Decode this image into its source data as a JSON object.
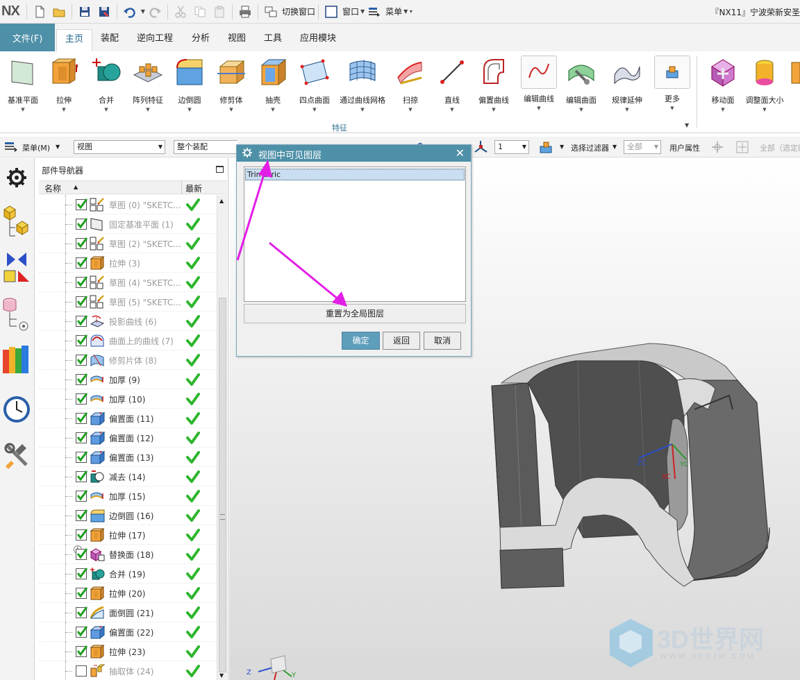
{
  "app": {
    "logo": "NX",
    "title": "『NX11』宁波荣新安圣"
  },
  "quick_access": {
    "switch_window": "切换窗口",
    "window": "窗口",
    "menu": "菜单"
  },
  "menu_tabs": {
    "file": "文件(F)",
    "tabs": [
      "主页",
      "装配",
      "逆向工程",
      "分析",
      "视图",
      "工具",
      "应用模块"
    ],
    "active": "主页"
  },
  "ribbon": {
    "group_label": "特征",
    "buttons": [
      "基准平面",
      "拉伸",
      "合并",
      "阵列特征",
      "边倒圆",
      "修剪体",
      "抽壳",
      "四点曲面",
      "通过曲线网格",
      "扫掠",
      "直线",
      "偏置曲线",
      "编辑曲线",
      "编辑曲面",
      "规律延伸",
      "更多",
      "移动面",
      "调整面大小"
    ]
  },
  "selection_bar": {
    "menu": "菜单(M)",
    "filter_view": "视图",
    "scope": "整个装配",
    "layer_text": "1",
    "select_filter": "选择过滤器",
    "all_box": "全部",
    "user_attr": "用户属性",
    "all_selected": "全部（选定的"
  },
  "navigator": {
    "title": "部件导航器",
    "col_name": "名称",
    "col_latest": "最新",
    "rows": [
      {
        "name": "草图 (0) \"SKETC...",
        "icon": "sketch-icon",
        "style": "gray",
        "checked": true
      },
      {
        "name": "固定基准平面 (1)",
        "icon": "datum-plane-icon",
        "style": "gray",
        "checked": true
      },
      {
        "name": "草图 (2) \"SKETC...",
        "icon": "sketch-icon",
        "style": "gray",
        "checked": true
      },
      {
        "name": "拉伸 (3)",
        "icon": "extrude-icon",
        "style": "gray",
        "checked": true
      },
      {
        "name": "草图 (4) \"SKETC...",
        "icon": "sketch-icon",
        "style": "gray",
        "checked": true
      },
      {
        "name": "草图 (5) \"SKETC...",
        "icon": "sketch-icon",
        "style": "gray",
        "checked": true
      },
      {
        "name": "投影曲线 (6)",
        "icon": "projected-curve-icon",
        "style": "gray",
        "checked": true
      },
      {
        "name": "曲面上的曲线 (7)",
        "icon": "curve-on-surface-icon",
        "style": "gray",
        "checked": true
      },
      {
        "name": "修剪片体 (8)",
        "icon": "trimmed-sheet-icon",
        "style": "gray",
        "checked": true
      },
      {
        "name": "加厚 (9)",
        "icon": "thicken-icon",
        "style": "dark",
        "checked": true
      },
      {
        "name": "加厚 (10)",
        "icon": "thicken-icon",
        "style": "dark",
        "checked": true
      },
      {
        "name": "偏置面 (11)",
        "icon": "offset-face-icon",
        "style": "dark",
        "checked": true
      },
      {
        "name": "偏置面 (12)",
        "icon": "offset-face-icon",
        "style": "dark",
        "checked": true
      },
      {
        "name": "偏置面 (13)",
        "icon": "offset-face-icon",
        "style": "dark",
        "checked": true
      },
      {
        "name": "减去 (14)",
        "icon": "subtract-icon",
        "style": "dark",
        "checked": true
      },
      {
        "name": "加厚 (15)",
        "icon": "thicken-icon",
        "style": "dark",
        "checked": true
      },
      {
        "name": "边倒圆 (16)",
        "icon": "edge-blend-icon",
        "style": "dark",
        "checked": true
      },
      {
        "name": "拉伸 (17)",
        "icon": "extrude-icon",
        "style": "dark",
        "checked": true
      },
      {
        "name": "替换面 (18)",
        "icon": "replace-face-icon",
        "style": "dark",
        "checked": true,
        "info": true
      },
      {
        "name": "合并 (19)",
        "icon": "unite-icon",
        "style": "dark",
        "checked": true
      },
      {
        "name": "拉伸 (20)",
        "icon": "extrude-icon",
        "style": "dark",
        "checked": true
      },
      {
        "name": "面倒圆 (21)",
        "icon": "face-blend-icon",
        "style": "dark",
        "checked": true
      },
      {
        "name": "偏置面 (22)",
        "icon": "offset-face-icon",
        "style": "dark",
        "checked": true
      },
      {
        "name": "拉伸 (23)",
        "icon": "extrude-icon",
        "style": "dark",
        "checked": true
      },
      {
        "name": "抽取体 (24)",
        "icon": "extract-body-icon",
        "style": "gray",
        "checked": false
      }
    ]
  },
  "dialog": {
    "title": "视图中可见图层",
    "list_items": [
      "Trimetric"
    ],
    "reset_button": "重置为全局图层",
    "ok": "确定",
    "back": "返回",
    "cancel": "取消"
  },
  "triad": {
    "zc": "ZC",
    "xc": "XC",
    "yc": "YC",
    "z": "Z",
    "y": "Y"
  },
  "watermark": {
    "text": "3D世界网",
    "sub": "WWW.3DSJW.COM"
  },
  "colors": {
    "accent": "#4e90a8",
    "annotation_arrow": "#e21ee6",
    "check_green": "#2db52d"
  }
}
